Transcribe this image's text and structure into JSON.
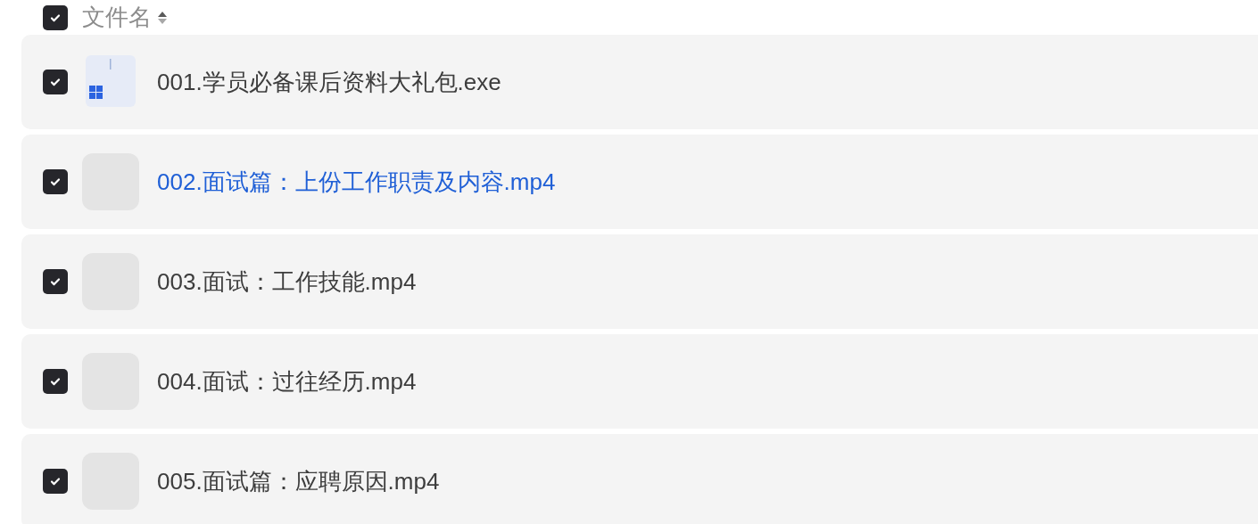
{
  "header": {
    "checked": true,
    "label": "文件名"
  },
  "files": [
    {
      "name": "001.学员必备课后资料大礼包.exe",
      "checked": true,
      "highlighted": false,
      "kind": "exe"
    },
    {
      "name": "002.面试篇：上份工作职责及内容.mp4",
      "checked": true,
      "highlighted": true,
      "kind": "video"
    },
    {
      "name": "003.面试：工作技能.mp4",
      "checked": true,
      "highlighted": false,
      "kind": "video"
    },
    {
      "name": "004.面试：过往经历.mp4",
      "checked": true,
      "highlighted": false,
      "kind": "video"
    },
    {
      "name": "005.面试篇：应聘原因.mp4",
      "checked": true,
      "highlighted": false,
      "kind": "video"
    }
  ]
}
